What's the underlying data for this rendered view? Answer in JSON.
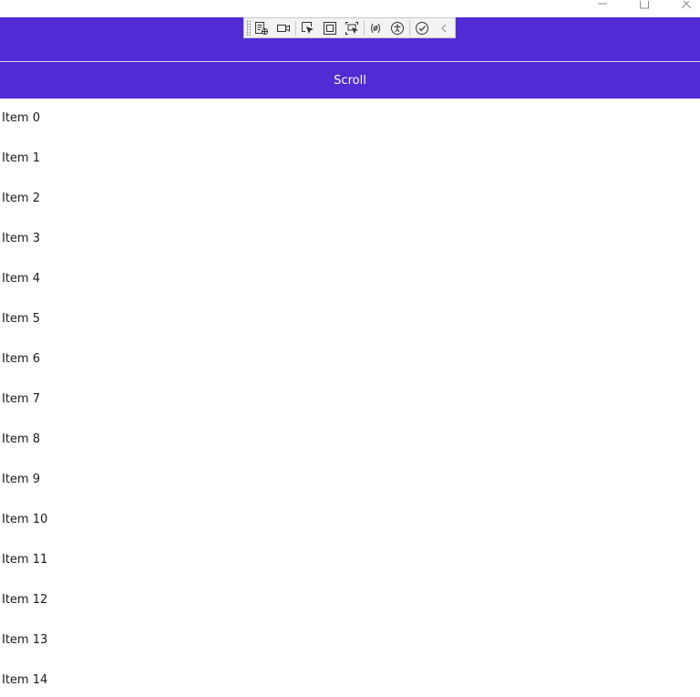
{
  "window": {
    "caption_buttons": [
      "minimize-icon",
      "maximize-icon",
      "close-icon"
    ]
  },
  "toolbar": {
    "tools": [
      "live-visual-tree-icon",
      "record-icon",
      "select-element-icon",
      "display-adorners-icon",
      "track-focus-icon",
      "binding-failures-icon",
      "accessibility-icon",
      "hot-reload-icon",
      "collapse-chevron-icon"
    ]
  },
  "nav": {
    "title": "Scroll"
  },
  "list": {
    "items": [
      "Item 0",
      "Item 1",
      "Item 2",
      "Item 3",
      "Item 4",
      "Item 5",
      "Item 6",
      "Item 7",
      "Item 8",
      "Item 9",
      "Item 10",
      "Item 11",
      "Item 12",
      "Item 13",
      "Item 14"
    ]
  },
  "colors": {
    "accent": "#512bd4",
    "text": "#1a1a1a",
    "nav_text": "#ffffff"
  }
}
